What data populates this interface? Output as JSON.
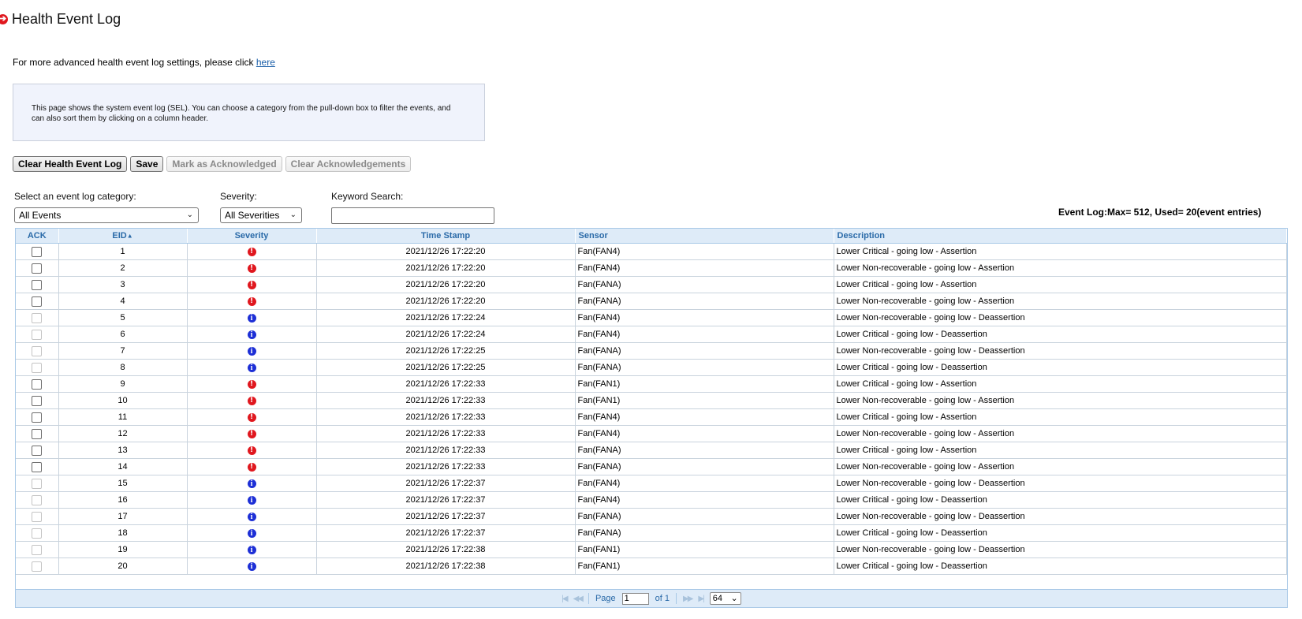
{
  "header": {
    "title": "Health Event Log",
    "icon": "arrow-right-circle-icon"
  },
  "advanced": {
    "text": "For more advanced health event log settings, please click ",
    "link": "here"
  },
  "info": "This page shows the system event log (SEL). You can choose a category from the pull-down box to filter the events, and can also sort them by clicking on a column header.",
  "buttons": {
    "clear_log": "Clear Health Event Log",
    "save": "Save",
    "mark_ack": "Mark as Acknowledged",
    "clear_ack": "Clear Acknowledgements"
  },
  "filters": {
    "category_label": "Select an event log category:",
    "category_value": "All Events",
    "severity_label": "Severity:",
    "severity_value": "All Severities",
    "keyword_label": "Keyword Search:",
    "keyword_value": ""
  },
  "usage": "Event Log:Max= 512, Used= 20(event entries)",
  "table": {
    "columns": [
      "ACK",
      "EID",
      "Severity",
      "Time Stamp",
      "Sensor",
      "Description"
    ],
    "sorted_column": "EID",
    "rows": [
      {
        "eid": "1",
        "severity": "critical",
        "time": "2021/12/26 17:22:20",
        "sensor": "Fan(FAN4)",
        "desc": "Lower Critical - going low - Assertion"
      },
      {
        "eid": "2",
        "severity": "critical",
        "time": "2021/12/26 17:22:20",
        "sensor": "Fan(FAN4)",
        "desc": "Lower Non-recoverable - going low - Assertion"
      },
      {
        "eid": "3",
        "severity": "critical",
        "time": "2021/12/26 17:22:20",
        "sensor": "Fan(FANA)",
        "desc": "Lower Critical - going low - Assertion"
      },
      {
        "eid": "4",
        "severity": "critical",
        "time": "2021/12/26 17:22:20",
        "sensor": "Fan(FANA)",
        "desc": "Lower Non-recoverable - going low - Assertion"
      },
      {
        "eid": "5",
        "severity": "info",
        "time": "2021/12/26 17:22:24",
        "sensor": "Fan(FAN4)",
        "desc": "Lower Non-recoverable - going low - Deassertion"
      },
      {
        "eid": "6",
        "severity": "info",
        "time": "2021/12/26 17:22:24",
        "sensor": "Fan(FAN4)",
        "desc": "Lower Critical - going low - Deassertion"
      },
      {
        "eid": "7",
        "severity": "info",
        "time": "2021/12/26 17:22:25",
        "sensor": "Fan(FANA)",
        "desc": "Lower Non-recoverable - going low - Deassertion"
      },
      {
        "eid": "8",
        "severity": "info",
        "time": "2021/12/26 17:22:25",
        "sensor": "Fan(FANA)",
        "desc": "Lower Critical - going low - Deassertion"
      },
      {
        "eid": "9",
        "severity": "critical",
        "time": "2021/12/26 17:22:33",
        "sensor": "Fan(FAN1)",
        "desc": "Lower Critical - going low - Assertion"
      },
      {
        "eid": "10",
        "severity": "critical",
        "time": "2021/12/26 17:22:33",
        "sensor": "Fan(FAN1)",
        "desc": "Lower Non-recoverable - going low - Assertion"
      },
      {
        "eid": "11",
        "severity": "critical",
        "time": "2021/12/26 17:22:33",
        "sensor": "Fan(FAN4)",
        "desc": "Lower Critical - going low - Assertion"
      },
      {
        "eid": "12",
        "severity": "critical",
        "time": "2021/12/26 17:22:33",
        "sensor": "Fan(FAN4)",
        "desc": "Lower Non-recoverable - going low - Assertion"
      },
      {
        "eid": "13",
        "severity": "critical",
        "time": "2021/12/26 17:22:33",
        "sensor": "Fan(FANA)",
        "desc": "Lower Critical - going low - Assertion"
      },
      {
        "eid": "14",
        "severity": "critical",
        "time": "2021/12/26 17:22:33",
        "sensor": "Fan(FANA)",
        "desc": "Lower Non-recoverable - going low - Assertion"
      },
      {
        "eid": "15",
        "severity": "info",
        "time": "2021/12/26 17:22:37",
        "sensor": "Fan(FAN4)",
        "desc": "Lower Non-recoverable - going low - Deassertion"
      },
      {
        "eid": "16",
        "severity": "info",
        "time": "2021/12/26 17:22:37",
        "sensor": "Fan(FAN4)",
        "desc": "Lower Critical - going low - Deassertion"
      },
      {
        "eid": "17",
        "severity": "info",
        "time": "2021/12/26 17:22:37",
        "sensor": "Fan(FANA)",
        "desc": "Lower Non-recoverable - going low - Deassertion"
      },
      {
        "eid": "18",
        "severity": "info",
        "time": "2021/12/26 17:22:37",
        "sensor": "Fan(FANA)",
        "desc": "Lower Critical - going low - Deassertion"
      },
      {
        "eid": "19",
        "severity": "info",
        "time": "2021/12/26 17:22:38",
        "sensor": "Fan(FAN1)",
        "desc": "Lower Non-recoverable - going low - Deassertion"
      },
      {
        "eid": "20",
        "severity": "info",
        "time": "2021/12/26 17:22:38",
        "sensor": "Fan(FAN1)",
        "desc": "Lower Critical - going low - Deassertion"
      }
    ]
  },
  "pager": {
    "page_label": "Page",
    "page_value": "1",
    "of_label": "of 1",
    "rows_per_page": "64"
  },
  "colors": {
    "critical": "#e0171e",
    "info": "#1d2fd6",
    "header_bg": "#deebf8",
    "header_text": "#2a6aa8"
  }
}
